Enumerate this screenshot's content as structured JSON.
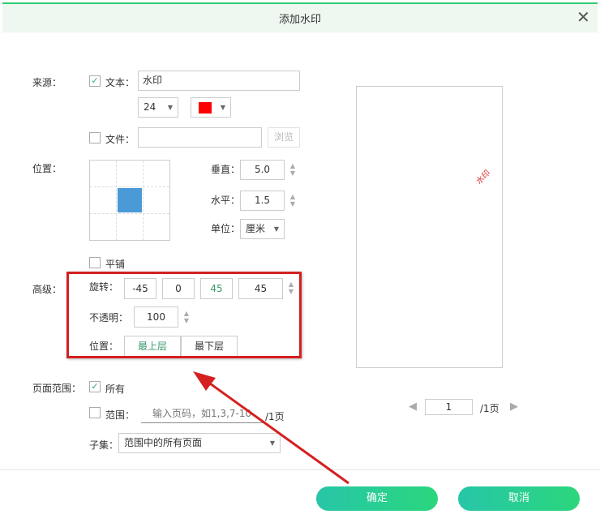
{
  "dialog": {
    "title": "添加水印",
    "close_icon": "close-icon"
  },
  "source": {
    "label": "来源：",
    "text_checked": true,
    "text_label": "文本：",
    "text_value": "水印",
    "font_size": "24",
    "color": "#ff0000",
    "file_checked": false,
    "file_label": "文件：",
    "file_value": "",
    "browse": "浏览"
  },
  "position": {
    "label": "位置：",
    "selected_cell": "center",
    "vertical_label": "垂直：",
    "vertical": "5.0",
    "horizontal_label": "水平：",
    "horizontal": "1.5",
    "unit_label": "单位：",
    "unit": "厘米",
    "tile_checked": false,
    "tile_label": "平铺"
  },
  "advanced": {
    "label": "高级：",
    "rotate_label": "旋转：",
    "rotate_presets": [
      "-45",
      "0",
      "45"
    ],
    "rotate_value": "45",
    "opacity_label": "不透明：",
    "opacity": "100",
    "layer_label": "位置：",
    "layer_options": [
      "最上层",
      "最下层"
    ]
  },
  "page_range": {
    "label": "页面范围：",
    "all_checked": true,
    "all_label": "所有",
    "range_checked": false,
    "range_label": "范围：",
    "range_placeholder": "输入页码，如1,3,7-10",
    "range_total": "/1页",
    "subset_label": "子集：",
    "subset": "范围中的所有页面"
  },
  "preview": {
    "watermark": "水印",
    "page": "1",
    "total": "/1页"
  },
  "footer": {
    "ok": "确定",
    "cancel": "取消"
  },
  "colors": {
    "accent": "#2bd67c",
    "annotation": "#d42020"
  }
}
